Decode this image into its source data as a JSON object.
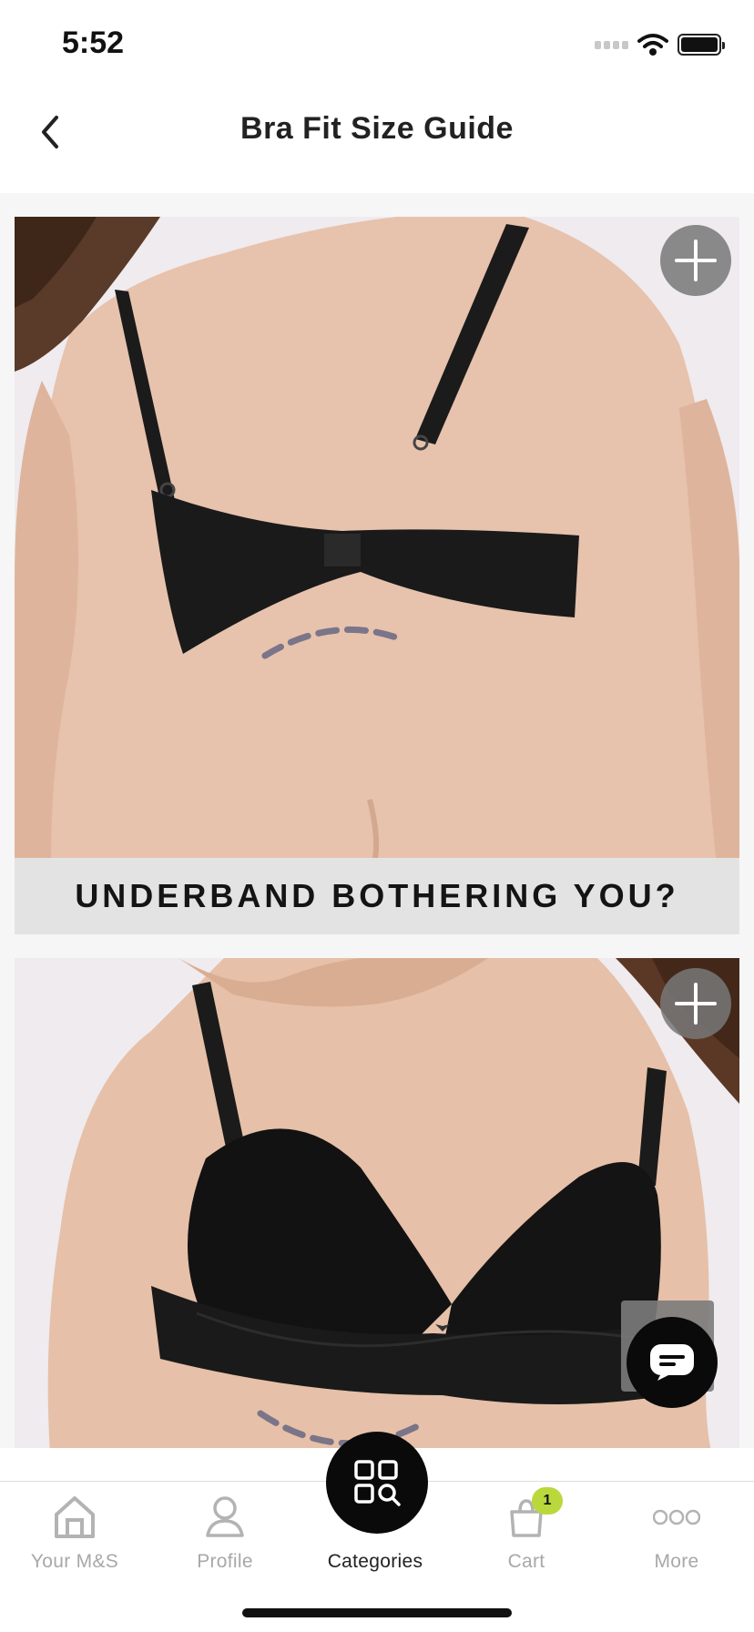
{
  "status_bar": {
    "time": "5:52"
  },
  "header": {
    "title": "Bra Fit Size Guide"
  },
  "cards": [
    {
      "caption": "UNDERBAND BOTHERING YOU?"
    }
  ],
  "bottom_nav": {
    "items": [
      {
        "label": "Your M&S"
      },
      {
        "label": "Profile"
      },
      {
        "label": "Categories"
      },
      {
        "label": "Cart",
        "badge": "1"
      },
      {
        "label": "More"
      }
    ]
  },
  "colors": {
    "accent_badge": "#b9d83c",
    "dark": "#0a0a0a"
  }
}
